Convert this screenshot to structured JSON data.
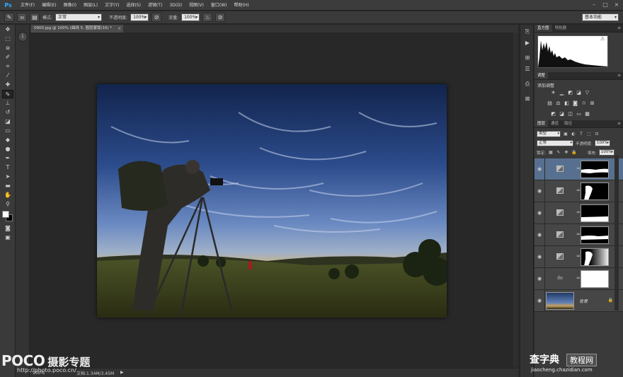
{
  "app": {
    "logo": "Ps",
    "menu": [
      "文件(F)",
      "编辑(E)",
      "图像(I)",
      "图层(L)",
      "文字(Y)",
      "选择(S)",
      "滤镜(T)",
      "3D(D)",
      "视图(V)",
      "窗口(W)",
      "帮助(H)"
    ]
  },
  "options": {
    "brush_size": "30",
    "mode_label": "模式:",
    "mode_value": "正常",
    "opacity_label": "不透明度:",
    "opacity_value": "100%",
    "flow_label": "流量:",
    "flow_value": "100%",
    "workspace": "基本功能"
  },
  "document": {
    "tab_title": "0900.jpg @ 100% (曲线 5, 图层蒙版/16) *",
    "zoom": "100%",
    "doc_size": "文档:1.34M/3.45M"
  },
  "panels": {
    "histogram_tabs": [
      "直方图",
      "导航器"
    ],
    "adjust_tab": "调整",
    "adjust_title": "添加调整",
    "layers_tabs": [
      "图层",
      "通道",
      "路径"
    ],
    "kind_filter": "类型",
    "blend_mode": "正常",
    "opacity_label": "不透明度:",
    "opacity_value": "100%",
    "lock_label": "锁定:",
    "fill_label": "填充:",
    "fill_value": "100%",
    "background_layer_name": "背景"
  },
  "watermarks": {
    "poco": "POCO",
    "poco_cn": "摄影专题",
    "poco_url": "http://photo.poco.cn/",
    "cz_title": "查字典",
    "cz_badge": "教程网",
    "cz_url": "jiaocheng.chazidian.com"
  }
}
